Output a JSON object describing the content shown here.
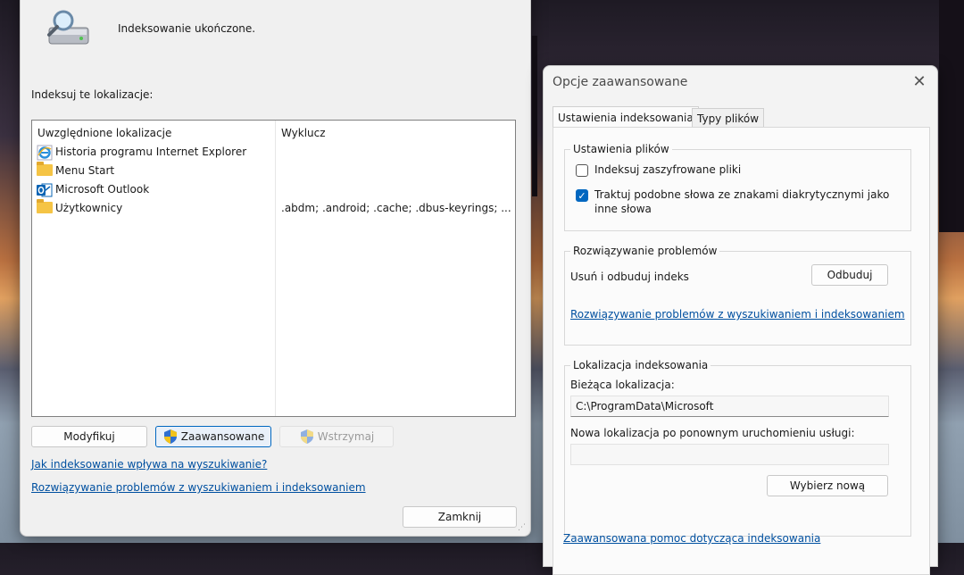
{
  "main": {
    "status": "Indeksowanie ukończone.",
    "locations_label": "Indeksuj te lokalizacje:",
    "columns": {
      "included": "Uwzględnione lokalizacje",
      "excluded": "Wyklucz"
    },
    "rows": [
      {
        "name": "Historia programu Internet Explorer",
        "icon": "internet-explorer-icon",
        "exclude": ""
      },
      {
        "name": "Menu Start",
        "icon": "folder-icon",
        "exclude": ""
      },
      {
        "name": "Microsoft Outlook",
        "icon": "outlook-icon",
        "exclude": ""
      },
      {
        "name": "Użytkownicy",
        "icon": "folder-icon",
        "exclude": ".abdm; .android; .cache; .dbus-keyrings; ..."
      }
    ],
    "buttons": {
      "modify": "Modyfikuj",
      "advanced": "Zaawansowane",
      "pause": "Wstrzymaj",
      "close": "Zamknij"
    },
    "links": {
      "how": "Jak indeksowanie wpływa na wyszukiwanie?",
      "troubleshoot": "Rozwiązywanie problemów z wyszukiwaniem i indeksowaniem"
    }
  },
  "advanced": {
    "title": "Opcje zaawansowane",
    "tabs": [
      "Ustawienia indeksowania",
      "Typy plików"
    ],
    "file_settings": {
      "title": "Ustawienia plików",
      "encrypt_label": "Indeksuj zaszyfrowane pliki",
      "encrypt_checked": false,
      "diacritics_line1": "Traktuj podobne słowa ze znakami diakrytycznymi jako",
      "diacritics_line2": "inne słowa",
      "diacritics_checked": true
    },
    "troubleshooting": {
      "title": "Rozwiązywanie problemów",
      "rebuild_label": "Usuń i odbuduj indeks",
      "rebuild_button": "Odbuduj",
      "link": "Rozwiązywanie problemów z wyszukiwaniem i indeksowaniem"
    },
    "location": {
      "title": "Lokalizacja indeksowania",
      "current_label": "Bieżąca lokalizacja:",
      "current_value": "C:\\ProgramData\\Microsoft",
      "new_label": "Nowa lokalizacja po ponownym uruchomieniu usługi:",
      "new_value": "",
      "select_button": "Wybierz nową"
    },
    "help_link": "Zaawansowana pomoc dotycząca indeksowania"
  },
  "colors": {
    "accent": "#0067c0",
    "link": "#0050a0"
  }
}
